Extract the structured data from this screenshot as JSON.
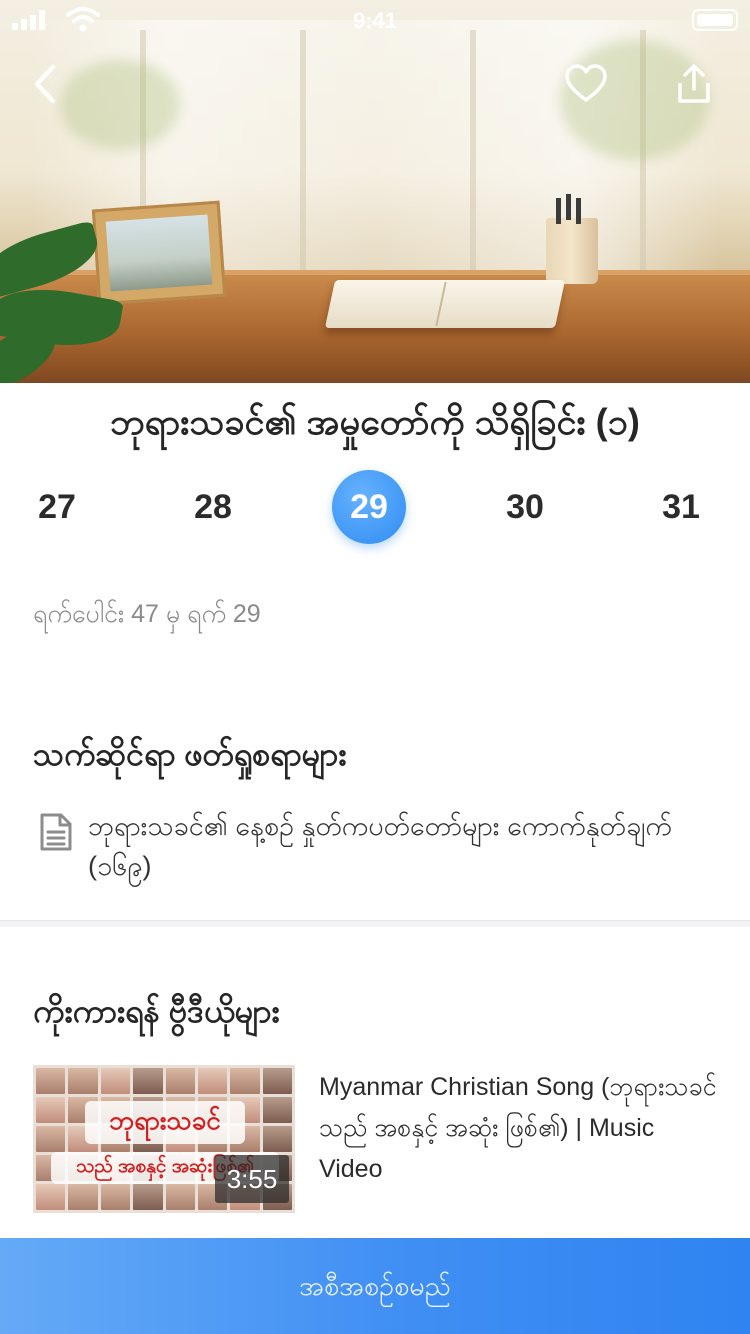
{
  "status_bar": {
    "time": "9:41"
  },
  "hero": {
    "back_icon": "chevron-left-icon",
    "favorite_icon": "heart-icon",
    "share_icon": "share-icon"
  },
  "plan": {
    "title": "ဘုရားသခင်၏ အမှုတော်ကို သိရှိခြင်း (၁)",
    "days": [
      "27",
      "28",
      "29",
      "30",
      "31"
    ],
    "selected_day": "29",
    "progress_text": "ရက်ပေါင်း 47 မှ ရက် 29"
  },
  "related": {
    "heading": "သက်ဆိုင်ရာ ဖတ်ရှုစရာများ",
    "icon": "document-icon",
    "item_text": "ဘုရားသခင်၏ နေ့စဉ် နှုတ်ကပတ်တော်များ ကောက်နုတ်ချက် (၁၆၉)"
  },
  "videos": {
    "heading": "ကိုးကားရန် ဗွီဒီယိုများ",
    "items": [
      {
        "title": "Myanmar Christian Song (ဘုရားသခင်သည် အစနှင့် အဆုံး ဖြစ်၏) | Music Video",
        "duration": "3:55",
        "thumb_line1": "ဘုရားသခင်",
        "thumb_line2": "သည် အစနှင့် အဆုံးဖြစ်၏"
      }
    ]
  },
  "start_button": {
    "label": "အစီအစဉ်စမည်"
  },
  "colors": {
    "accent": "#2f8cf1",
    "button_start": "#64aaf7",
    "button_end": "#2f84f2"
  }
}
